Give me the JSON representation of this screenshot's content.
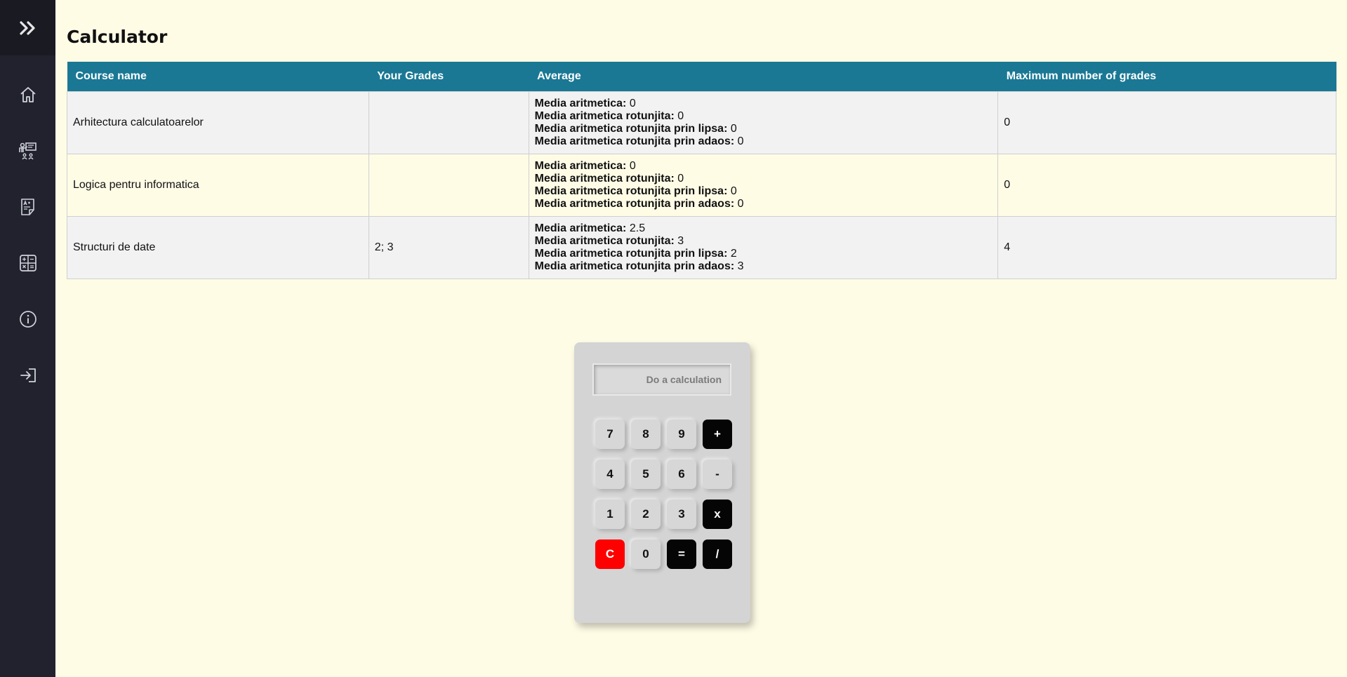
{
  "sidebar": {
    "toggle_icon": "double-chevron-right-icon",
    "items": [
      {
        "name": "home",
        "icon": "home-icon"
      },
      {
        "name": "classroom",
        "icon": "teacher-board-icon"
      },
      {
        "name": "grades",
        "icon": "grade-sheet-icon"
      },
      {
        "name": "calculator",
        "icon": "calculator-icon"
      },
      {
        "name": "info",
        "icon": "info-icon"
      },
      {
        "name": "login",
        "icon": "sign-in-icon"
      }
    ]
  },
  "page": {
    "title": "Calculator"
  },
  "table": {
    "headers": {
      "course": "Course name",
      "grades": "Your Grades",
      "average": "Average",
      "max": "Maximum number of grades"
    },
    "labels": {
      "arith": "Media aritmetica:",
      "rounded": "Media aritmetica rotunjita:",
      "floor": "Media aritmetica rotunjita prin lipsa:",
      "ceil": "Media aritmetica rotunjita prin adaos:"
    },
    "rows": [
      {
        "course": "Arhitectura calculatoarelor",
        "grades": "",
        "arith": "0",
        "rounded": "0",
        "floor": "0",
        "ceil": "0",
        "max": "0"
      },
      {
        "course": "Logica pentru informatica",
        "grades": "",
        "arith": "0",
        "rounded": "0",
        "floor": "0",
        "ceil": "0",
        "max": "0"
      },
      {
        "course": "Structuri de date",
        "grades": "2; 3",
        "arith": "2.5",
        "rounded": "3",
        "floor": "2",
        "ceil": "3",
        "max": "4"
      }
    ]
  },
  "calculator": {
    "placeholder": "Do a calculation",
    "keys": [
      "7",
      "8",
      "9",
      "+",
      "4",
      "5",
      "6",
      "-",
      "1",
      "2",
      "3",
      "x",
      "C",
      "0",
      "=",
      "/"
    ],
    "colors": {
      "clear": "#ff0000",
      "operator": "#050505",
      "key": "#d7d7d7",
      "body": "#d4d4d4",
      "header": "#1a7894"
    }
  }
}
